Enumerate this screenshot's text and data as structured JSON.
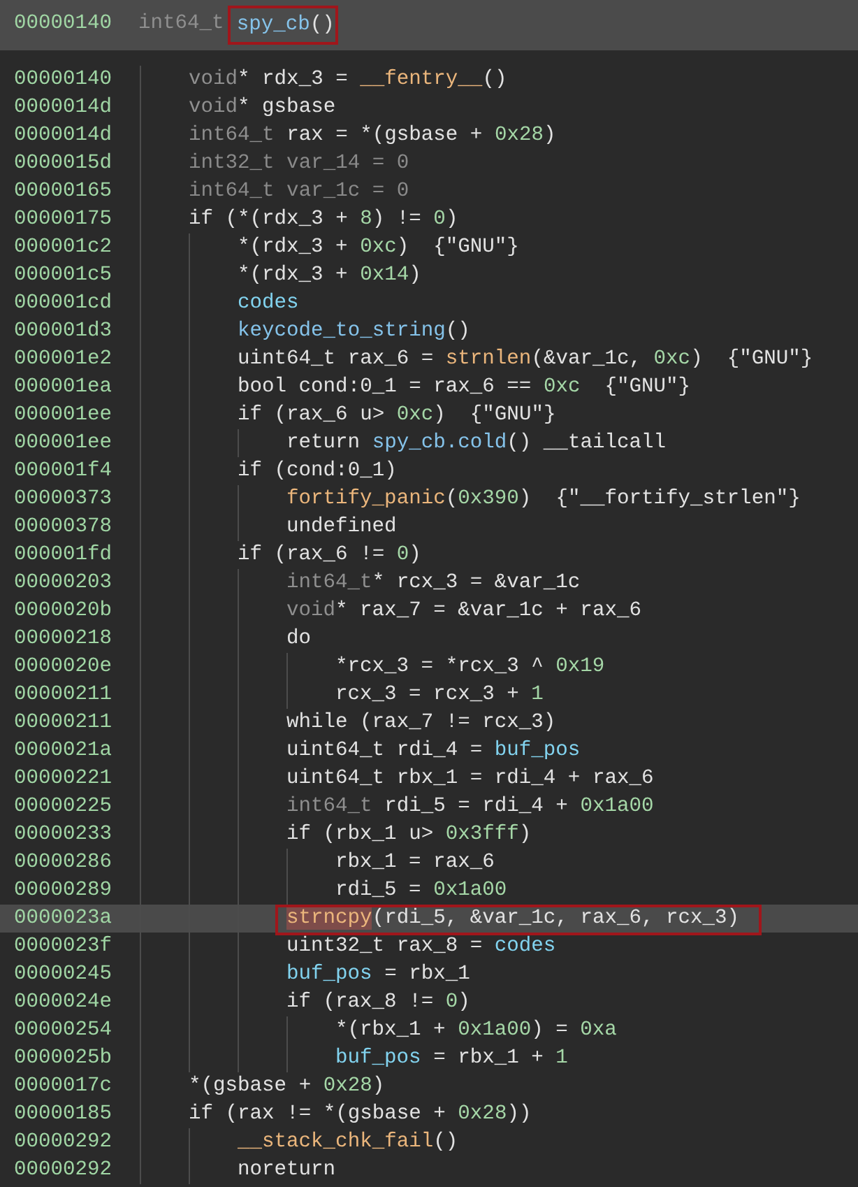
{
  "header": {
    "address": "00000140",
    "return_type": "int64_t",
    "name": "spy_cb",
    "params": "()",
    "framed": true
  },
  "lines": [
    {
      "address": "00000140",
      "selected": false,
      "framed": false,
      "tokens": [
        {
          "kind": "type",
          "text": "void"
        },
        {
          "kind": "plain",
          "text": "* rdx_3 = "
        },
        {
          "kind": "func",
          "text": "__fentry__"
        },
        {
          "kind": "plain",
          "text": "()"
        }
      ]
    },
    {
      "address": "0000014d",
      "selected": false,
      "framed": false,
      "tokens": [
        {
          "kind": "type",
          "text": "void"
        },
        {
          "kind": "plain",
          "text": "* gsbase"
        }
      ]
    },
    {
      "address": "0000014d",
      "selected": false,
      "framed": false,
      "tokens": [
        {
          "kind": "type",
          "text": "int64_t"
        },
        {
          "kind": "plain",
          "text": " rax = *(gsbase + "
        },
        {
          "kind": "number",
          "text": "0x28"
        },
        {
          "kind": "plain",
          "text": ")"
        }
      ]
    },
    {
      "address": "0000015d",
      "selected": false,
      "framed": false,
      "tokens": [
        {
          "kind": "dim",
          "text": "int32_t var_14 = 0"
        }
      ]
    },
    {
      "address": "00000165",
      "selected": false,
      "framed": false,
      "tokens": [
        {
          "kind": "dim",
          "text": "int64_t var_1c = 0"
        }
      ]
    },
    {
      "address": "00000175",
      "selected": false,
      "framed": false,
      "tokens": [
        {
          "kind": "plain",
          "text": "if (*(rdx_3 + "
        },
        {
          "kind": "number",
          "text": "8"
        },
        {
          "kind": "plain",
          "text": ") != "
        },
        {
          "kind": "number",
          "text": "0"
        },
        {
          "kind": "plain",
          "text": ")"
        }
      ],
      "children": [
        {
          "address": "000001c2",
          "selected": false,
          "framed": false,
          "tokens": [
            {
              "kind": "plain",
              "text": "*(rdx_3 + "
            },
            {
              "kind": "number",
              "text": "0xc"
            },
            {
              "kind": "plain",
              "text": ")  {\"GNU\"}"
            }
          ]
        },
        {
          "address": "000001c5",
          "selected": false,
          "framed": false,
          "tokens": [
            {
              "kind": "plain",
              "text": "*(rdx_3 + "
            },
            {
              "kind": "number",
              "text": "0x14"
            },
            {
              "kind": "plain",
              "text": ")"
            }
          ]
        },
        {
          "address": "000001cd",
          "selected": false,
          "framed": false,
          "tokens": [
            {
              "kind": "data",
              "text": "codes"
            }
          ]
        },
        {
          "address": "000001d3",
          "selected": false,
          "framed": false,
          "tokens": [
            {
              "kind": "local_func",
              "text": "keycode_to_string"
            },
            {
              "kind": "plain",
              "text": "()"
            }
          ]
        },
        {
          "address": "000001e2",
          "selected": false,
          "framed": false,
          "tokens": [
            {
              "kind": "plain",
              "text": "uint64_t rax_6 = "
            },
            {
              "kind": "func",
              "text": "strnlen"
            },
            {
              "kind": "plain",
              "text": "(&var_1c, "
            },
            {
              "kind": "number",
              "text": "0xc"
            },
            {
              "kind": "plain",
              "text": ")  {\"GNU\"}"
            }
          ]
        },
        {
          "address": "000001ea",
          "selected": false,
          "framed": false,
          "tokens": [
            {
              "kind": "plain",
              "text": "bool cond:0_1 = rax_6 == "
            },
            {
              "kind": "number",
              "text": "0xc"
            },
            {
              "kind": "plain",
              "text": "  {\"GNU\"}"
            }
          ]
        },
        {
          "address": "000001ee",
          "selected": false,
          "framed": false,
          "tokens": [
            {
              "kind": "plain",
              "text": "if (rax_6 u> "
            },
            {
              "kind": "number",
              "text": "0xc"
            },
            {
              "kind": "plain",
              "text": ")  {\"GNU\"}"
            }
          ],
          "children": [
            {
              "address": "000001ee",
              "selected": false,
              "framed": false,
              "tokens": [
                {
                  "kind": "plain",
                  "text": "return "
                },
                {
                  "kind": "local_func",
                  "text": "spy_cb.cold"
                },
                {
                  "kind": "plain",
                  "text": "() __tailcall"
                }
              ]
            }
          ]
        },
        {
          "address": "000001f4",
          "selected": false,
          "framed": false,
          "tokens": [
            {
              "kind": "plain",
              "text": "if (cond:0_1)"
            }
          ],
          "children": [
            {
              "address": "00000373",
              "selected": false,
              "framed": false,
              "tokens": [
                {
                  "kind": "func",
                  "text": "fortify_panic"
                },
                {
                  "kind": "plain",
                  "text": "("
                },
                {
                  "kind": "number",
                  "text": "0x390"
                },
                {
                  "kind": "plain",
                  "text": ")  {\"__fortify_strlen\"}"
                }
              ]
            },
            {
              "address": "00000378",
              "selected": false,
              "framed": false,
              "tokens": [
                {
                  "kind": "plain",
                  "text": "undefined"
                }
              ]
            }
          ]
        },
        {
          "address": "000001fd",
          "selected": false,
          "framed": false,
          "tokens": [
            {
              "kind": "plain",
              "text": "if (rax_6 != "
            },
            {
              "kind": "number",
              "text": "0"
            },
            {
              "kind": "plain",
              "text": ")"
            }
          ],
          "children": [
            {
              "address": "00000203",
              "selected": false,
              "framed": false,
              "tokens": [
                {
                  "kind": "type",
                  "text": "int64_t"
                },
                {
                  "kind": "plain",
                  "text": "* rcx_3 = &var_1c"
                }
              ]
            },
            {
              "address": "0000020b",
              "selected": false,
              "framed": false,
              "tokens": [
                {
                  "kind": "type",
                  "text": "void"
                },
                {
                  "kind": "plain",
                  "text": "* rax_7 = &var_1c + rax_6"
                }
              ]
            },
            {
              "address": "00000218",
              "selected": false,
              "framed": false,
              "tokens": [
                {
                  "kind": "plain",
                  "text": "do"
                }
              ],
              "children": [
                {
                  "address": "0000020e",
                  "selected": false,
                  "framed": false,
                  "tokens": [
                    {
                      "kind": "plain",
                      "text": "*rcx_3 = *rcx_3 ^ "
                    },
                    {
                      "kind": "number",
                      "text": "0x19"
                    }
                  ]
                },
                {
                  "address": "00000211",
                  "selected": false,
                  "framed": false,
                  "tokens": [
                    {
                      "kind": "plain",
                      "text": "rcx_3 = rcx_3 + "
                    },
                    {
                      "kind": "number",
                      "text": "1"
                    }
                  ]
                }
              ]
            },
            {
              "address": "00000211",
              "selected": false,
              "framed": false,
              "tokens": [
                {
                  "kind": "plain",
                  "text": "while (rax_7 != rcx_3)"
                }
              ]
            },
            {
              "address": "0000021a",
              "selected": false,
              "framed": false,
              "tokens": [
                {
                  "kind": "plain",
                  "text": "uint64_t rdi_4 = "
                },
                {
                  "kind": "data",
                  "text": "buf_pos"
                }
              ]
            },
            {
              "address": "00000221",
              "selected": false,
              "framed": false,
              "tokens": [
                {
                  "kind": "plain",
                  "text": "uint64_t rbx_1 = rdi_4 + rax_6"
                }
              ]
            },
            {
              "address": "00000225",
              "selected": false,
              "framed": false,
              "tokens": [
                {
                  "kind": "type",
                  "text": "int64_t"
                },
                {
                  "kind": "plain",
                  "text": " rdi_5 = rdi_4 + "
                },
                {
                  "kind": "number",
                  "text": "0x1a00"
                }
              ]
            },
            {
              "address": "00000233",
              "selected": false,
              "framed": false,
              "tokens": [
                {
                  "kind": "plain",
                  "text": "if (rbx_1 u> "
                },
                {
                  "kind": "number",
                  "text": "0x3fff"
                },
                {
                  "kind": "plain",
                  "text": ")"
                }
              ],
              "children": [
                {
                  "address": "00000286",
                  "selected": false,
                  "framed": false,
                  "tokens": [
                    {
                      "kind": "plain",
                      "text": "rbx_1 = rax_6"
                    }
                  ]
                },
                {
                  "address": "00000289",
                  "selected": false,
                  "framed": false,
                  "tokens": [
                    {
                      "kind": "plain",
                      "text": "rdi_5 = "
                    },
                    {
                      "kind": "number",
                      "text": "0x1a00"
                    }
                  ]
                }
              ]
            },
            {
              "address": "0000023a",
              "selected": true,
              "framed": true,
              "tokens": [
                {
                  "kind": "highlight",
                  "text": "strncpy"
                },
                {
                  "kind": "plain",
                  "text": "(rdi_5, &var_1c, rax_6, rcx_3)"
                }
              ]
            },
            {
              "address": "0000023f",
              "selected": false,
              "framed": false,
              "tokens": [
                {
                  "kind": "plain",
                  "text": "uint32_t rax_8 = "
                },
                {
                  "kind": "data",
                  "text": "codes"
                }
              ]
            },
            {
              "address": "00000245",
              "selected": false,
              "framed": false,
              "tokens": [
                {
                  "kind": "data",
                  "text": "buf_pos"
                },
                {
                  "kind": "plain",
                  "text": " = rbx_1"
                }
              ]
            },
            {
              "address": "0000024e",
              "selected": false,
              "framed": false,
              "tokens": [
                {
                  "kind": "plain",
                  "text": "if (rax_8 != "
                },
                {
                  "kind": "number",
                  "text": "0"
                },
                {
                  "kind": "plain",
                  "text": ")"
                }
              ],
              "children": [
                {
                  "address": "00000254",
                  "selected": false,
                  "framed": false,
                  "tokens": [
                    {
                      "kind": "plain",
                      "text": "*(rbx_1 + "
                    },
                    {
                      "kind": "number",
                      "text": "0x1a00"
                    },
                    {
                      "kind": "plain",
                      "text": ") = "
                    },
                    {
                      "kind": "number",
                      "text": "0xa"
                    }
                  ]
                },
                {
                  "address": "0000025b",
                  "selected": false,
                  "framed": false,
                  "tokens": [
                    {
                      "kind": "data",
                      "text": "buf_pos"
                    },
                    {
                      "kind": "plain",
                      "text": " = rbx_1 + "
                    },
                    {
                      "kind": "number",
                      "text": "1"
                    }
                  ]
                }
              ]
            }
          ]
        }
      ]
    },
    {
      "address": "0000017c",
      "selected": false,
      "framed": false,
      "tokens": [
        {
          "kind": "plain",
          "text": "*(gsbase + "
        },
        {
          "kind": "number",
          "text": "0x28"
        },
        {
          "kind": "plain",
          "text": ")"
        }
      ]
    },
    {
      "address": "00000185",
      "selected": false,
      "framed": false,
      "tokens": [
        {
          "kind": "plain",
          "text": "if (rax != *(gsbase + "
        },
        {
          "kind": "number",
          "text": "0x28"
        },
        {
          "kind": "plain",
          "text": "))"
        }
      ],
      "children": [
        {
          "address": "00000292",
          "selected": false,
          "framed": false,
          "tokens": [
            {
              "kind": "func",
              "text": "__stack_chk_fail"
            },
            {
              "kind": "plain",
              "text": "()"
            }
          ]
        },
        {
          "address": "00000292",
          "selected": false,
          "framed": false,
          "tokens": [
            {
              "kind": "plain",
              "text": "noreturn"
            }
          ]
        }
      ]
    }
  ]
}
